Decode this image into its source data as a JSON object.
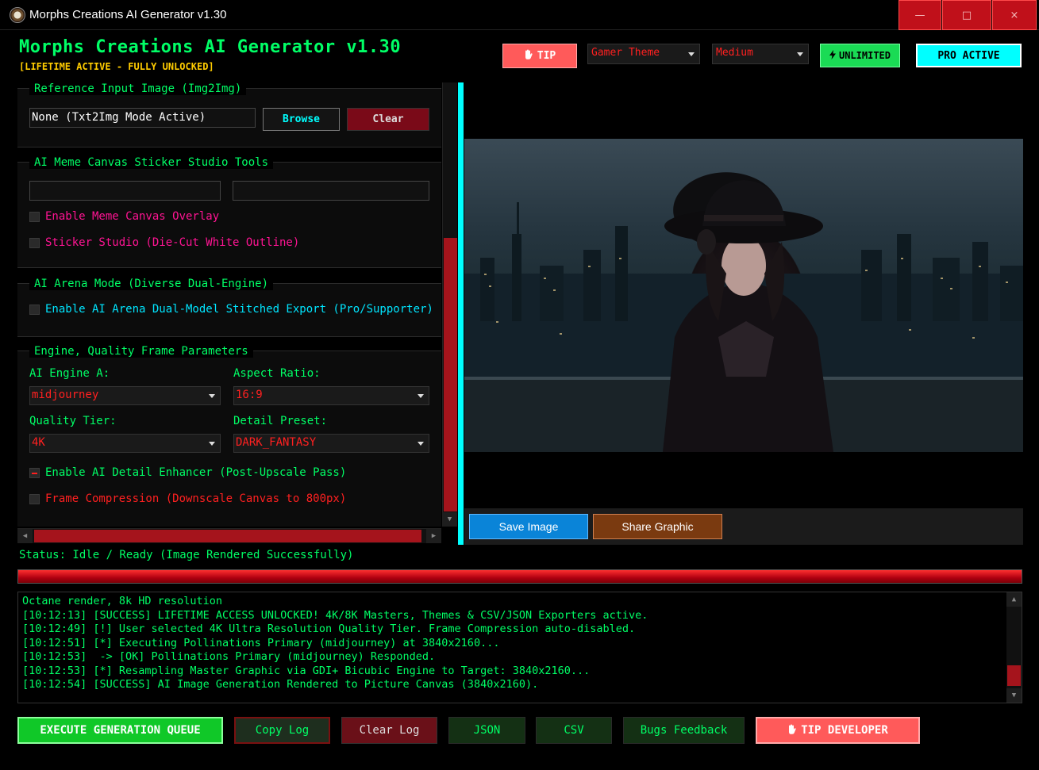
{
  "window": {
    "title": "Morphs Creations AI Generator v1.30",
    "minimize": "—",
    "maximize": "□",
    "close": "×"
  },
  "header": {
    "app_title": "Morphs Creations AI Generator v1.30",
    "lifetime": "[LIFETIME ACTIVE - FULLY UNLOCKED]",
    "tip_icon": "hand-icon",
    "tip_label": "TIP",
    "theme_value": "Gamer Theme",
    "quality_value": "Medium",
    "unlimited_icon": "lightning-icon",
    "unlimited_label": "UNLIMITED",
    "pro_label": "PRO ACTIVE"
  },
  "reference": {
    "title": "Reference Input Image (Img2Img)",
    "path_value": "None (Txt2Img Mode Active)",
    "browse_label": "Browse",
    "clear_label": "Clear"
  },
  "meme": {
    "title": "AI Meme Canvas Sticker Studio Tools",
    "top_text_value": "",
    "bottom_text_value": "",
    "enable_overlay_label": "Enable Meme Canvas Overlay",
    "enable_overlay_checked": false,
    "sticker_label": "Sticker Studio (Die-Cut White Outline)",
    "sticker_checked": false
  },
  "arena": {
    "title": "AI Arena Mode (Diverse Dual-Engine)",
    "enable_label": "Enable AI Arena Dual-Model Stitched Export (Pro/Supporter)",
    "enable_checked": false
  },
  "engine": {
    "title": "Engine, Quality Frame Parameters",
    "engine_a_label": "AI Engine A:",
    "engine_a_value": "midjourney",
    "aspect_label": "Aspect Ratio:",
    "aspect_value": "16:9",
    "quality_label": "Quality Tier:",
    "quality_value": "4K",
    "detail_label": "Detail Preset:",
    "detail_value": "DARK_FANTASY",
    "enhancer_label": "Enable AI Detail Enhancer (Post-Upscale Pass)",
    "enhancer_checked": true,
    "compression_label": "Frame Compression (Downscale Canvas to 800px)",
    "compression_checked": false
  },
  "preview": {
    "save_label": "Save Image",
    "share_label": "Share Graphic"
  },
  "status": {
    "text": "Status: Idle / Ready (Image Rendered Successfully)",
    "progress": 1.0
  },
  "log": {
    "lines": [
      "Octane render, 8k HD resolution",
      "[10:12:13] [SUCCESS] LIFETIME ACCESS UNLOCKED! 4K/8K Masters, Themes & CSV/JSON Exporters active.",
      "[10:12:49] [!] User selected 4K Ultra Resolution Quality Tier. Frame Compression auto-disabled.",
      "[10:12:51] [*] Executing Pollinations Primary (midjourney) at 3840x2160...",
      "[10:12:53]  -> [OK] Pollinations Primary (midjourney) Responded.",
      "[10:12:53] [*] Resampling Master Graphic via GDI+ Bicubic Engine to Target: 3840x2160...",
      "[10:12:54] [SUCCESS] AI Image Generation Rendered to Picture Canvas (3840x2160)."
    ]
  },
  "actions": {
    "execute_label": "EXECUTE GENERATION QUEUE",
    "copy_log_label": "Copy Log",
    "clear_log_label": "Clear Log",
    "json_label": "JSON",
    "csv_label": "CSV",
    "bugs_label": "Bugs Feedback",
    "tip_dev_icon": "hand-icon",
    "tip_dev_label": "TIP DEVELOPER"
  },
  "colors": {
    "accent_green": "#00ff66",
    "accent_red": "#ff2020",
    "accent_cyan": "#00ffff",
    "accent_gold": "#ffcc00",
    "meme_magenta": "#ff1493",
    "arena_cyan": "#00e5ff"
  }
}
